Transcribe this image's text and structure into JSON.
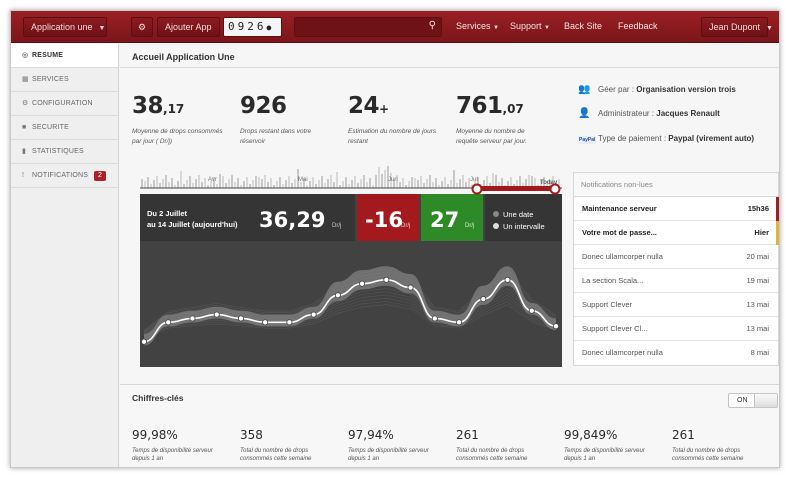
{
  "topbar": {
    "app_selector": "Application une",
    "add_app_label": "Ajouter App",
    "counter": "0926",
    "search": {
      "placeholder": "",
      "value": ""
    },
    "nav": [
      "Services",
      "Support",
      "Back Site",
      "Feedback"
    ],
    "user": "Jean Dupont"
  },
  "sidebar": {
    "items": [
      {
        "label": "RESUME",
        "icon": "target-icon",
        "active": true
      },
      {
        "label": "SERVICES",
        "icon": "grid-icon"
      },
      {
        "label": "CONFIGURATION",
        "icon": "gear-icon"
      },
      {
        "label": "SECURITE",
        "icon": "lock-icon"
      },
      {
        "label": "STATISTIQUES",
        "icon": "bar-chart-icon"
      },
      {
        "label": "NOTIFICATIONS",
        "icon": "exclamation-icon",
        "badge": "2"
      }
    ]
  },
  "page": {
    "title": "Accueil Application Une"
  },
  "stats": [
    {
      "value": "38",
      "suffix": ",17",
      "desc": "Moyenne de drops consommés par jour ( Dr/j)"
    },
    {
      "value": "926",
      "suffix": "",
      "desc": "Drops restant dans votre réservoir"
    },
    {
      "value": "24",
      "suffix": "+",
      "desc": "Estimation du nombre de jours restant"
    },
    {
      "value": "761",
      "suffix": ",07",
      "desc": "Moyenne du nombre de requête serveur par jour."
    }
  ],
  "info": {
    "managed_by_label": "Géer par :",
    "managed_by": "Organisation version trois",
    "admin_label": "Administrateur :",
    "admin": "Jacques Renault",
    "payment_label": "Type de paiement :",
    "payment": "Paypal (virement auto)",
    "paypal_logo": "PayPal"
  },
  "chart_panel": {
    "range_line1": "Du 2 Juillet",
    "range_line2": "au 14 Juillet (aujourd'hui)",
    "value": "36,29",
    "value_unit": "Dr/j",
    "red_value": "-16",
    "red_unit": "Dr/j",
    "green_value": "27",
    "green_unit": "Dr/j",
    "option_date": "Une date",
    "option_interval": "Un intervalle",
    "timeline_months": [
      "Avr",
      "Mai",
      "Jun",
      "Jul"
    ],
    "timeline_today": "Today"
  },
  "chart_data": {
    "type": "line",
    "x": [
      1,
      2,
      3,
      4,
      5,
      6,
      7,
      8,
      9,
      10,
      11,
      12,
      13,
      14,
      15,
      16,
      17,
      18
    ],
    "series": [
      {
        "values": [
          5,
          10,
          11,
          12,
          11,
          10,
          10,
          12,
          17,
          20,
          21,
          19,
          11,
          10,
          16,
          21,
          13,
          9
        ]
      }
    ],
    "ylim": [
      0,
      30
    ],
    "grid": false
  },
  "notifications": {
    "title": "Notifications non-lues",
    "items": [
      {
        "title": "Maintenance serveur",
        "date": "15h36",
        "bold": true,
        "flag": "#9f1e24"
      },
      {
        "title": "Votre mot de passe...",
        "date": "Hier",
        "bold": true,
        "flag": "#e2b23a"
      },
      {
        "title": "Donec ullamcorper nulla",
        "date": "20 mai"
      },
      {
        "title": "La section Scala...",
        "date": "19 mai"
      },
      {
        "title": "Support Clever",
        "date": "13 mai"
      },
      {
        "title": "Support Clever Cl...",
        "date": "13 mai"
      },
      {
        "title": "Donec ullamcorper nulla",
        "date": "8 mai"
      }
    ]
  },
  "kpis": {
    "title": "Chiffres-clés",
    "toggle": "ON",
    "items": [
      {
        "value": "99,98%",
        "desc": "Temps de disponibilité serveur depuis 1 an"
      },
      {
        "value": "358",
        "desc": "Total du nombre de drops consommés cette semaine"
      },
      {
        "value": "97,94%",
        "desc": "Temps de disponibilité serveur depuis 1 an"
      },
      {
        "value": "261",
        "desc": "Total du nombre de drops consommés cette semaine"
      },
      {
        "value": "99,849%",
        "desc": "Temps de disponibilité serveur depuis 1 an"
      },
      {
        "value": "261",
        "desc": "Total du nombre de drops consommés cette semaine"
      }
    ]
  },
  "colors": {
    "brand": "#8b1a1f",
    "red": "#a3191e",
    "green": "#2e8a26"
  }
}
